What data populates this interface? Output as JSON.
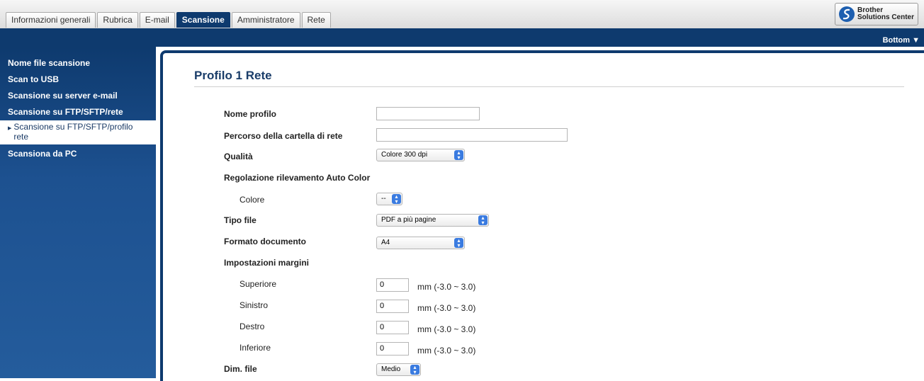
{
  "tabs": [
    "Informazioni generali",
    "Rubrica",
    "E-mail",
    "Scansione",
    "Amministratore",
    "Rete"
  ],
  "active_tab": "Scansione",
  "brother": {
    "line1": "Brother",
    "line2": "Solutions Center"
  },
  "bottom_link": "Bottom ▼",
  "sidebar": {
    "items": [
      "Nome file scansione",
      "Scan to USB",
      "Scansione su server e-mail",
      "Scansione su FTP/SFTP/rete",
      "Scansione su FTP/SFTP/profilo rete",
      "Scansiona da PC"
    ],
    "active_item": "Scansione su FTP/SFTP/profilo rete"
  },
  "page_title": "Profilo 1 Rete",
  "form": {
    "nome_profilo": {
      "label": "Nome profilo",
      "value": ""
    },
    "percorso": {
      "label": "Percorso della cartella di rete",
      "value": ""
    },
    "qualita": {
      "label": "Qualità",
      "value": "Colore 300 dpi"
    },
    "auto_color": {
      "label": "Regolazione rilevamento Auto Color"
    },
    "colore": {
      "label": "Colore",
      "value": "--"
    },
    "tipo_file": {
      "label": "Tipo file",
      "value": "PDF a più pagine"
    },
    "formato": {
      "label": "Formato documento",
      "value": "A4"
    },
    "margini": {
      "label": "Impostazioni margini"
    },
    "superiore": {
      "label": "Superiore",
      "value": "0",
      "unit": "mm (-3.0 ~ 3.0)"
    },
    "sinistro": {
      "label": "Sinistro",
      "value": "0",
      "unit": "mm (-3.0 ~ 3.0)"
    },
    "destro": {
      "label": "Destro",
      "value": "0",
      "unit": "mm (-3.0 ~ 3.0)"
    },
    "inferiore": {
      "label": "Inferiore",
      "value": "0",
      "unit": "mm (-3.0 ~ 3.0)"
    },
    "dim_file": {
      "label": "Dim. file",
      "value": "Medio"
    }
  },
  "colors": {
    "navy": "#0e3a6e",
    "accent": "#3a7be0"
  }
}
